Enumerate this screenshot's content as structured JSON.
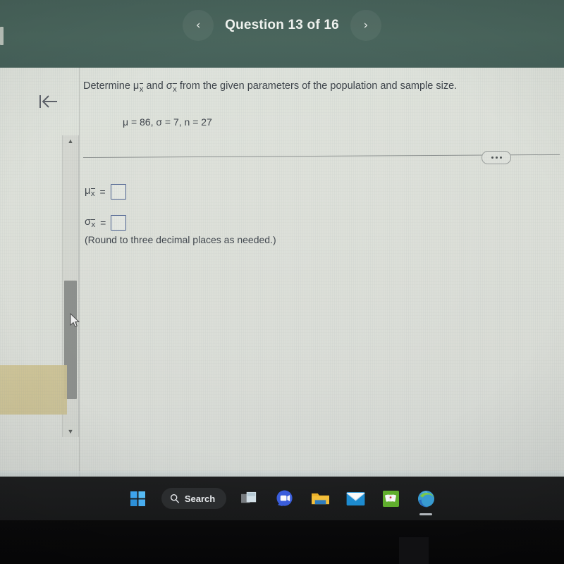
{
  "header": {
    "prev_label": "‹",
    "title": "Question 13 of 16",
    "next_label": "›"
  },
  "content": {
    "prompt_before": "Determine ",
    "prompt_mu": "μ",
    "prompt_sub1": "x",
    "prompt_middle": " and ",
    "prompt_sigma": "σ",
    "prompt_sub2": "x",
    "prompt_after": " from the given parameters of the population and sample size.",
    "parameters": "μ = 86, σ = 7, n = 27",
    "ellipsis_label": "...",
    "answer_mu_symbol": "μ",
    "answer_mu_sub": "x",
    "answer_sigma_symbol": "σ",
    "answer_sigma_sub": "x",
    "equals": "=",
    "answer_mu_value": "",
    "answer_sigma_value": "",
    "round_note": "(Round to three decimal places as needed.)"
  },
  "sidebar": {
    "collapse_label": "collapse panel",
    "scroll_up_label": "▲",
    "scroll_down_label": "▼"
  },
  "taskbar": {
    "start_label": "Start",
    "search_label": "Search",
    "items": [
      {
        "name": "task-view",
        "label": "Task View"
      },
      {
        "name": "meetings",
        "label": "Meet"
      },
      {
        "name": "file-explorer",
        "label": "File Explorer"
      },
      {
        "name": "mail",
        "label": "Mail"
      },
      {
        "name": "solitaire",
        "label": "Solitaire"
      },
      {
        "name": "edge",
        "label": "Microsoft Edge"
      }
    ]
  },
  "colors": {
    "header_green": "#4a665d",
    "page_bg": "#dcdfd8",
    "taskbar_bg": "#1e1f20",
    "input_border": "#4a5f8f",
    "text": "#3c4249",
    "tan_reflection": "#cbc091"
  }
}
